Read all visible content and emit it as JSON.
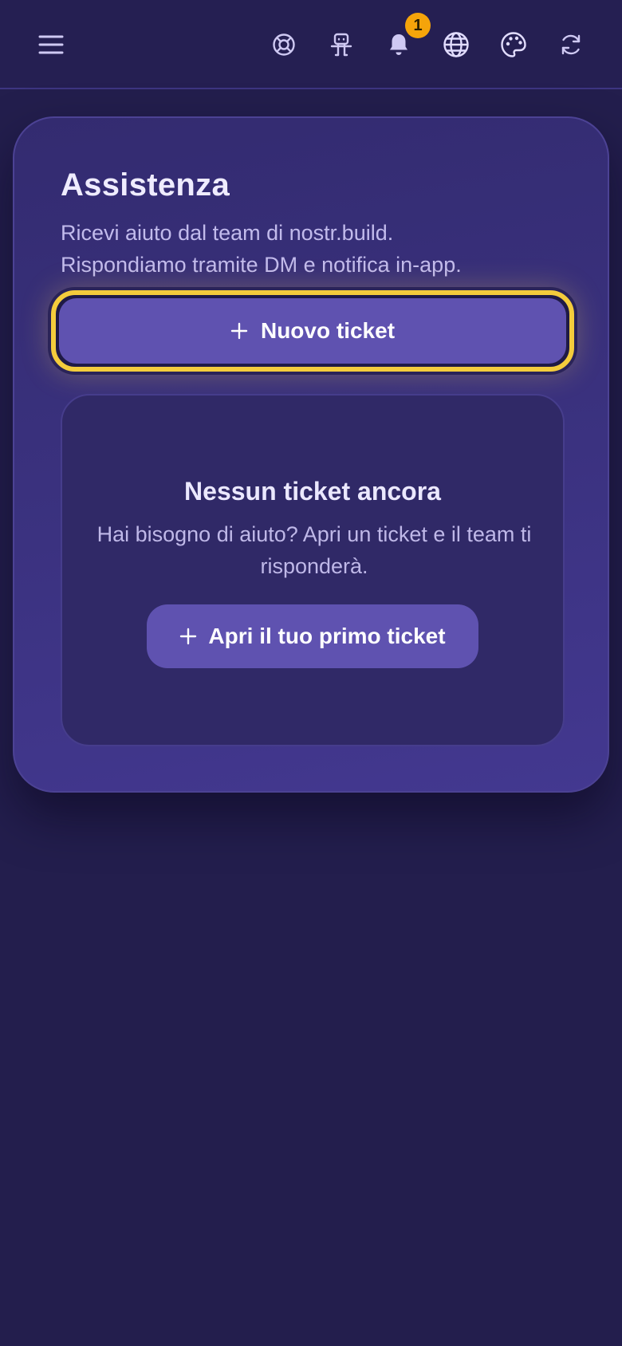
{
  "header": {
    "icons": {
      "menu": "menu-icon",
      "support": "lifebuoy-icon",
      "nostr": "robot-icon",
      "notifications": "bell-icon",
      "language": "globe-icon",
      "theme": "palette-icon",
      "refresh": "refresh-icon"
    },
    "notification_count": "1"
  },
  "support": {
    "title": "Assistenza",
    "subtitle_line1": "Ricevi aiuto dal team di nostr.build.",
    "subtitle_line2": "Rispondiamo tramite DM e notifica in-app.",
    "new_ticket_label": "Nuovo ticket"
  },
  "empty_state": {
    "title": "Nessun ticket ancora",
    "text": "Hai bisogno di aiuto? Apri un ticket e il team ti risponderà.",
    "button_label": "Apri il tuo primo ticket"
  },
  "colors": {
    "background": "#231e4d",
    "card": "#3b3280",
    "accent": "#5f52b0",
    "focus_ring": "#f4cc3c",
    "badge": "#f5a40a"
  }
}
